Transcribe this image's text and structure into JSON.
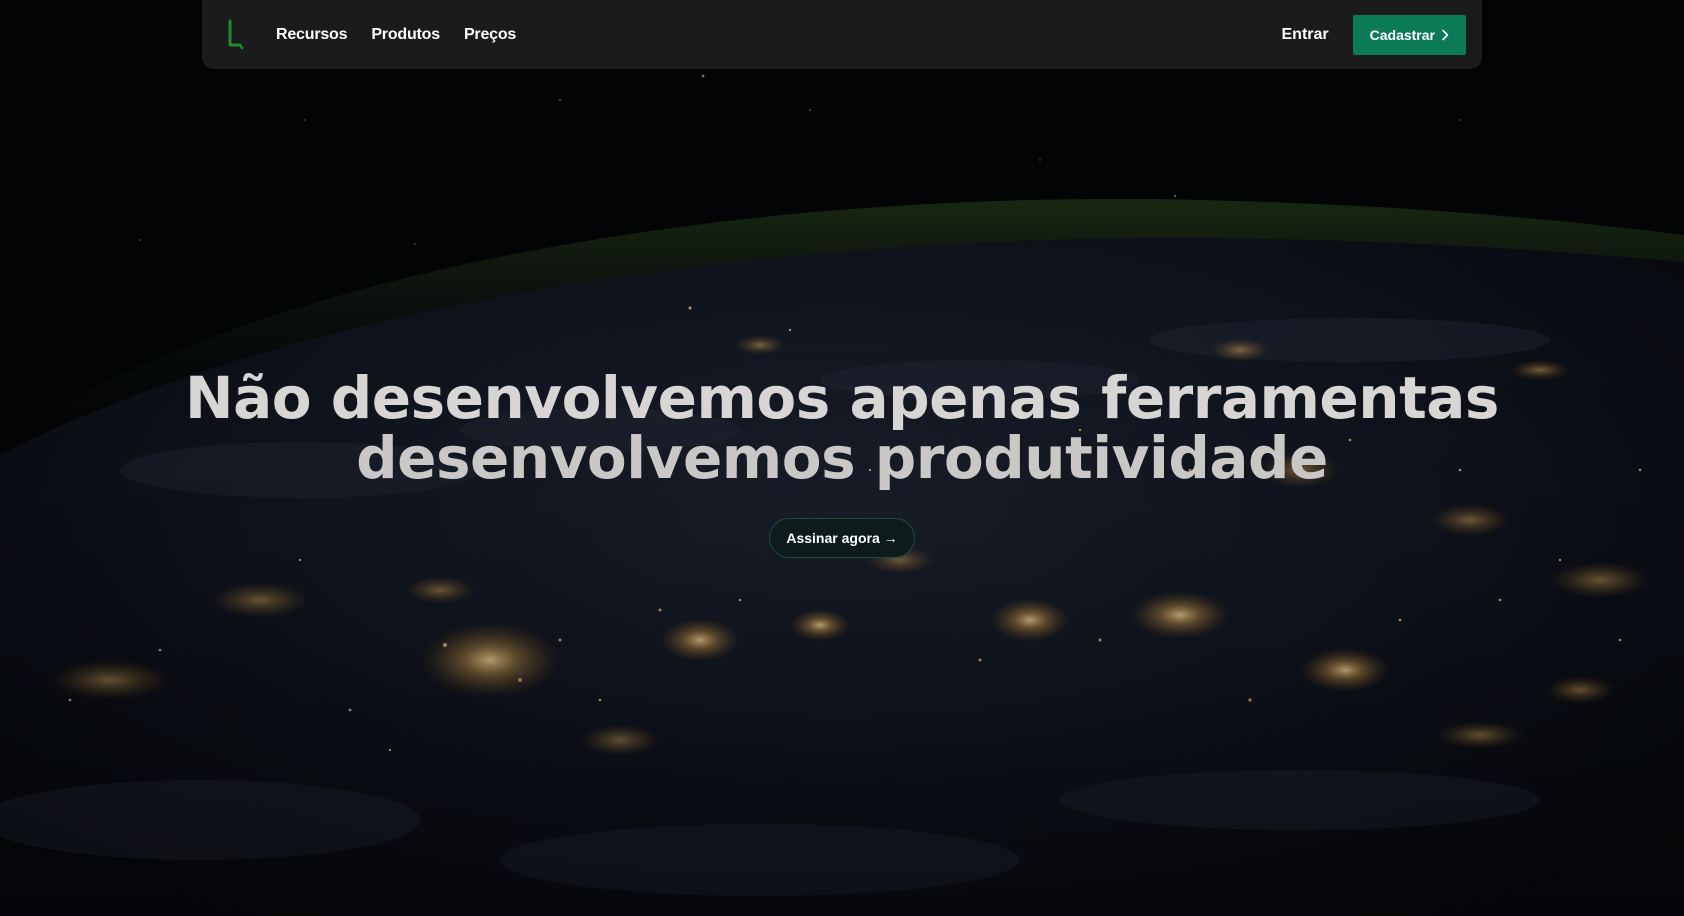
{
  "nav": {
    "logo_icon": "green-l-logo-icon",
    "links": [
      {
        "label": "Recursos"
      },
      {
        "label": "Produtos"
      },
      {
        "label": "Preços"
      }
    ],
    "signin_label": "Entrar",
    "signup_label": "Cadastrar",
    "signup_icon": "chevron-right-icon"
  },
  "hero": {
    "title_line1": "Não desenvolvemos apenas ferramentas",
    "title_line2": "desenvolvemos produtividade",
    "cta_label": "Assinar agora →",
    "background": "earth-at-night-from-space-image"
  },
  "colors": {
    "nav_bg": "#1b1a1c",
    "accent": "#0b7a56",
    "logo": "#1f8a2a",
    "cta_bg": "#0d1c1a",
    "page_bg": "#030405"
  }
}
